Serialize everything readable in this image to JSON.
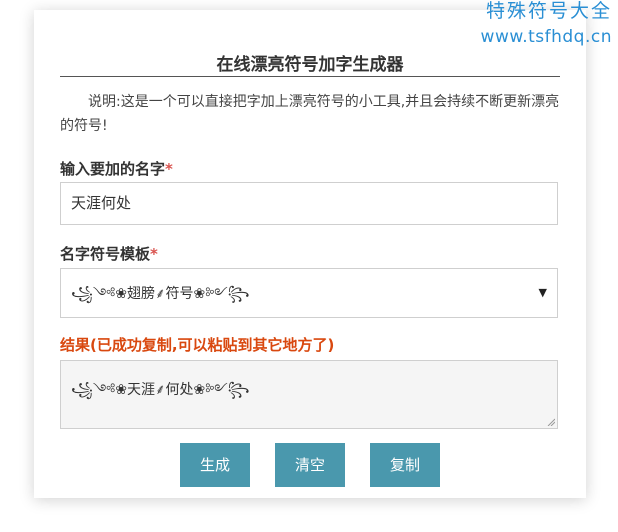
{
  "watermark": {
    "title": "特殊符号大全",
    "url": "www.tsfhdq.cn"
  },
  "tool": {
    "title": "在线漂亮符号加字生成器",
    "description": "说明:这是一个可以直接把字加上漂亮符号的小工具,并且会持续不断更新漂亮的符号!"
  },
  "form": {
    "name_label": "输入要加的名字",
    "name_required": "*",
    "name_value": "天涯何处",
    "template_label": "名字符号模板",
    "template_required": "*",
    "template_selected": "꧁༺❀翅膀⸙符号❀༻꧂",
    "result_label": "结果(已成功复制,可以粘贴到其它地方了)",
    "result_value": "꧁༺❀天涯⸙何处❀༻꧂"
  },
  "buttons": {
    "generate": "生成",
    "clear": "清空",
    "copy": "复制"
  },
  "colors": {
    "button": "#4a98ad",
    "watermark": "#2a8fd4",
    "result_label": "#d9480f",
    "required": "#d9534f"
  }
}
